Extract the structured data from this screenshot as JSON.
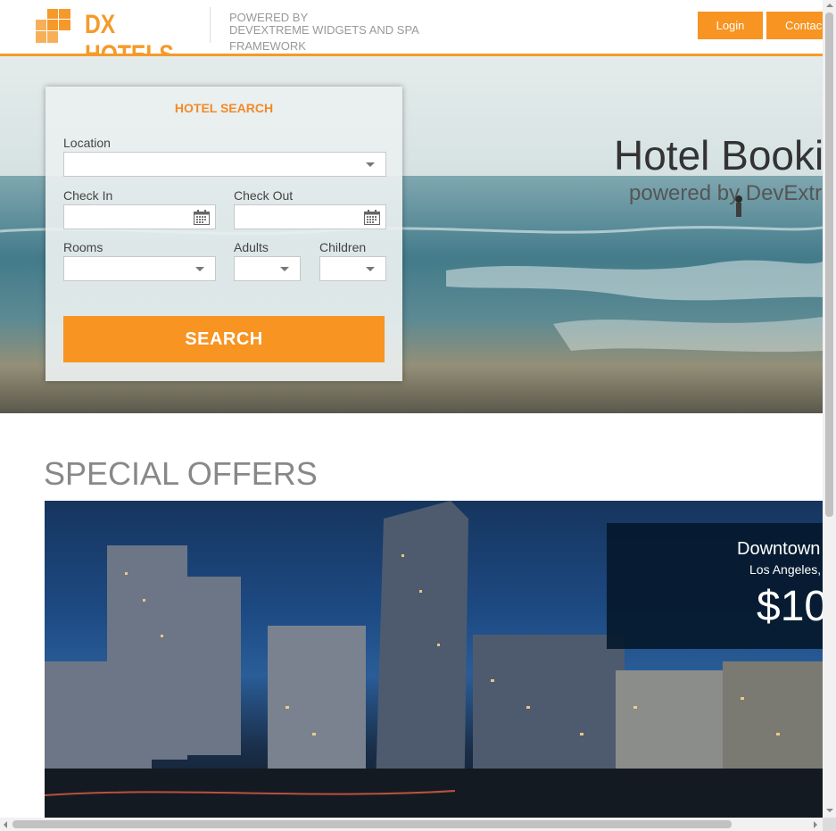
{
  "header": {
    "logo_text": "DX HOTELS",
    "powered_line1": "POWERED BY",
    "powered_line2": "DEVEXTREME WIDGETS AND SPA",
    "powered_line3": "FRAMEWORK",
    "login_label": "Login",
    "contact_label": "Contac"
  },
  "hero": {
    "title": "Hotel Booki",
    "subtitle": "powered by DevExtr"
  },
  "search": {
    "title": "HOTEL SEARCH",
    "location_label": "Location",
    "location_value": "",
    "checkin_label": "Check In",
    "checkin_value": "",
    "checkout_label": "Check Out",
    "checkout_value": "",
    "rooms_label": "Rooms",
    "rooms_value": "",
    "adults_label": "Adults",
    "adults_value": "",
    "children_label": "Children",
    "children_value": "",
    "button_label": "SEARCH"
  },
  "offers": {
    "title": "SPECIAL OFFERS",
    "items": [
      {
        "name": "Downtown",
        "location": "Los Angeles,",
        "price": "$10"
      }
    ]
  },
  "colors": {
    "accent": "#f79422",
    "offer_panel": "#05192d"
  }
}
